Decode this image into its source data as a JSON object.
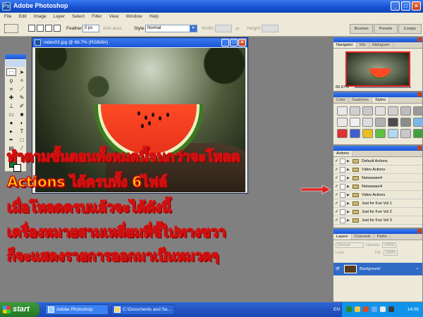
{
  "window": {
    "title": "Adobe Photoshop"
  },
  "menu": [
    "File",
    "Edit",
    "Image",
    "Layer",
    "Select",
    "Filter",
    "View",
    "Window",
    "Help"
  ],
  "options": {
    "feather_label": "Feather:",
    "feather_value": "0 px",
    "antialias_label": "Anti-alias",
    "style_label": "Style:",
    "style_value": "Normal",
    "width_label": "Width:",
    "height_label": "Height:"
  },
  "palette_well": [
    "Brushes",
    "Presets",
    "Comps"
  ],
  "document": {
    "title": "index03.jpg @ 66.7% (RGB/8#)"
  },
  "navigator": {
    "tabs": [
      "Navigator",
      "Info",
      "Histogram"
    ],
    "zoom": "66.67%"
  },
  "styles_panel": {
    "tabs": [
      "Color",
      "Swatches",
      "Styles"
    ],
    "swatches": [
      "#e8e8e8",
      "#d0d0d0",
      "#c8c8c8",
      "#e0e0e0",
      "#cfcfcf",
      "#bdbdbd",
      "#9a9a9a",
      "#e8e8e8",
      "#f0f0f0",
      "#dcdcdc",
      "#b0b0b0",
      "#4c4c4c",
      "#8a8a8a",
      "#7ab8e8",
      "#e03030",
      "#4060d0",
      "#e8c020",
      "#60c040",
      "#b0d8f0",
      "#c8c8c8",
      "#40a040"
    ]
  },
  "actions": {
    "tab": "Actions",
    "items": [
      "Default Actions",
      "Video Actions",
      "Noiseware4",
      "Noiseware4",
      "Video Actions",
      "Just for Fun Vol 1",
      "Just for Fun Vol 2",
      "Just for Fun Vol 3"
    ]
  },
  "layers": {
    "tabs": [
      "Layers",
      "Channels",
      "Paths"
    ],
    "blend": "Normal",
    "opacity_label": "Opacity:",
    "opacity": "100%",
    "lock_label": "Lock:",
    "fill_label": "Fill:",
    "fill": "100%",
    "layer_name": "Background"
  },
  "annotation": {
    "lines": [
      "ทำตามขั้นตอนทั้งหมดนี้จนกว่าจะโหลด",
      "Actions ได้ครบทั้ง 6ไฟล์",
      "เมื่อโหลดครบแล้วจะได้ดังนี้",
      "เครื่องหมายสามเหลี่ยมที่ชี้ไปทางขวา",
      "ก็จะแสดงรายการออกมาเป็นหมวดๆ"
    ]
  },
  "taskbar": {
    "start": "start",
    "tasks": [
      "Adobe Photoshop",
      "C:\\Documents and Se..."
    ],
    "lang": "EN",
    "clock": "14:06"
  }
}
